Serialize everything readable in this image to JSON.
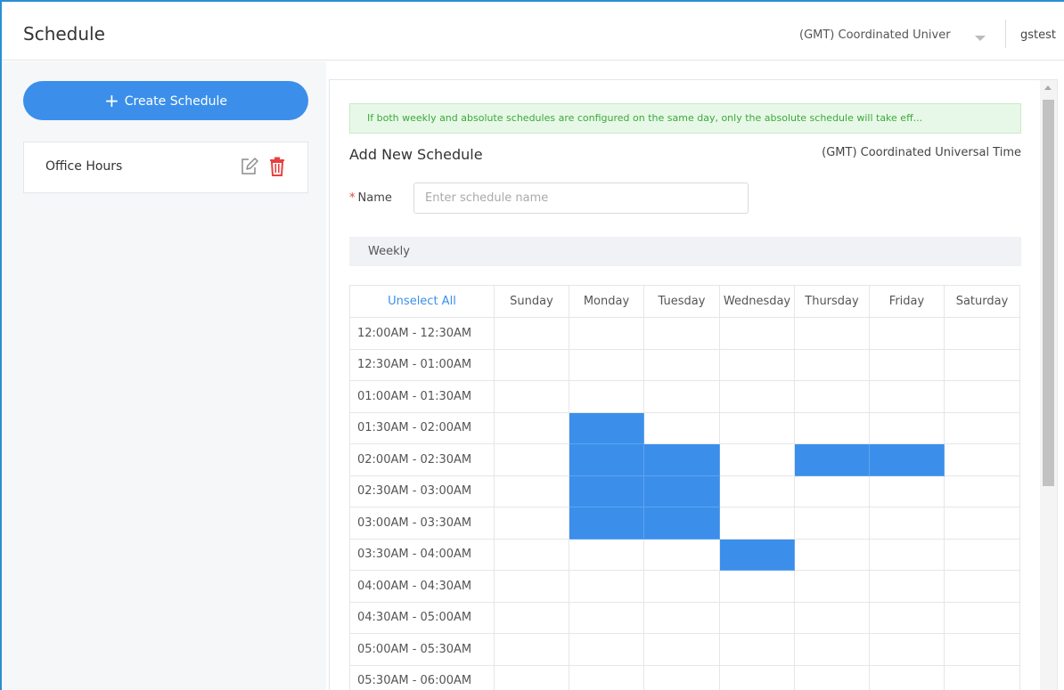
{
  "header": {
    "title": "Schedule",
    "timezone": "(GMT) Coordinated Univer",
    "user": "gstest"
  },
  "sidebar": {
    "create_label": "Create Schedule",
    "schedules": [
      {
        "label": "Office Hours"
      }
    ]
  },
  "main": {
    "notice": "If both weekly and absolute schedules are configured on the same day, only the absolute schedule will take eff...",
    "section_title": "Add New Schedule",
    "timezone_label": "(GMT) Coordinated Universal Time",
    "name_label": "Name",
    "name_placeholder": "Enter schedule name",
    "weekly_label": "Weekly"
  },
  "grid": {
    "unselect_label": "Unselect All",
    "days": [
      "Sunday",
      "Monday",
      "Tuesday",
      "Wednesday",
      "Thursday",
      "Friday",
      "Saturday"
    ],
    "times": [
      "12:00AM - 12:30AM",
      "12:30AM - 01:00AM",
      "01:00AM - 01:30AM",
      "01:30AM - 02:00AM",
      "02:00AM - 02:30AM",
      "02:30AM - 03:00AM",
      "03:00AM - 03:30AM",
      "03:30AM - 04:00AM",
      "04:00AM - 04:30AM",
      "04:30AM - 05:00AM",
      "05:00AM - 05:30AM",
      "05:30AM - 06:00AM"
    ],
    "selected": [
      [
        0,
        0,
        0,
        0,
        0,
        0,
        0
      ],
      [
        0,
        0,
        0,
        0,
        0,
        0,
        0
      ],
      [
        0,
        0,
        0,
        0,
        0,
        0,
        0
      ],
      [
        0,
        1,
        0,
        0,
        0,
        0,
        0
      ],
      [
        0,
        1,
        1,
        0,
        1,
        1,
        0
      ],
      [
        0,
        1,
        1,
        0,
        0,
        0,
        0
      ],
      [
        0,
        1,
        1,
        0,
        0,
        0,
        0
      ],
      [
        0,
        0,
        0,
        1,
        0,
        0,
        0
      ],
      [
        0,
        0,
        0,
        0,
        0,
        0,
        0
      ],
      [
        0,
        0,
        0,
        0,
        0,
        0,
        0
      ],
      [
        0,
        0,
        0,
        0,
        0,
        0,
        0
      ],
      [
        0,
        0,
        0,
        0,
        0,
        0,
        0
      ]
    ],
    "selected_color": "#3b8fea"
  },
  "colors": {
    "accent": "#3b8fea",
    "danger": "#e84040",
    "notice_text": "#3aa93a",
    "notice_bg": "#e8f8e8"
  },
  "icons": {
    "add": "plus-icon",
    "edit": "edit-icon",
    "delete": "trash-icon",
    "timezone_dropdown": "chevron-down-icon",
    "scroll_up": "arrow-up-icon"
  }
}
